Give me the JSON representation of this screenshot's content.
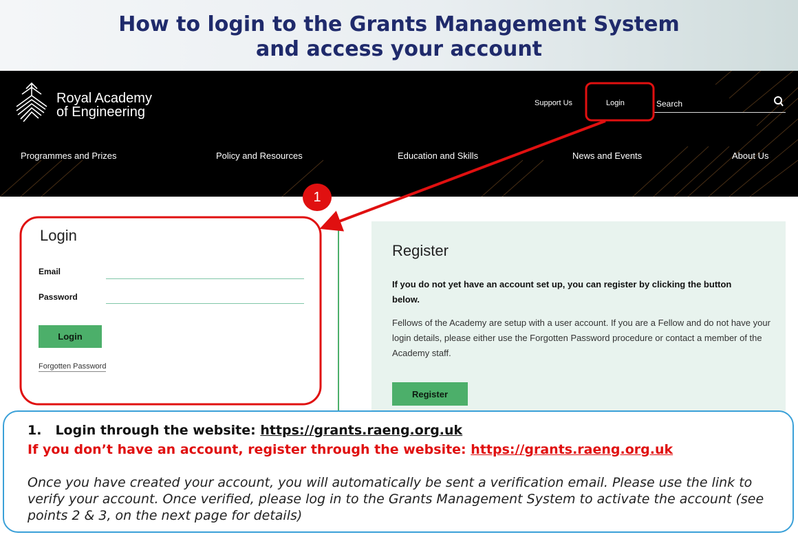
{
  "banner": {
    "line1": "How to login to the Grants Management System",
    "line2": "and access your account"
  },
  "site_header": {
    "logo_line1": "Royal Academy",
    "logo_line2": "of Engineering",
    "support_label": "Support Us",
    "login_label": "Login",
    "search_placeholder": "Search",
    "nav": [
      "Programmes and Prizes",
      "Policy and Resources",
      "Education and Skills",
      "News and Events",
      "About Us"
    ]
  },
  "login_form": {
    "title": "Login",
    "email_label": "Email",
    "password_label": "Password",
    "button_label": "Login",
    "forgot_label": "Forgotten Password"
  },
  "register_panel": {
    "title": "Register",
    "bold_text": "If you do not yet have an account set up, you can register by clicking the button below.",
    "body_text": "Fellows of the Academy are setup with a user account. If you are a Fellow and do not have your login details, please either use the Forgotten Password procedure or contact a member of the Academy staff.",
    "button_label": "Register"
  },
  "annotation": {
    "badge": "1",
    "colors": {
      "highlight": "#e01010",
      "callout_border": "#3aa0d8",
      "brand_green": "#4caf6a",
      "title_navy": "#1f2a6b"
    }
  },
  "callout": {
    "step_number": "1.",
    "step_text": "Login through the website:",
    "step_link": "https://grants.raeng.org.uk",
    "register_text": "If you don’t have an account, register through the website:",
    "register_link": "https://grants.raeng.org.uk",
    "note": "Once you have created your account, you will automatically be sent a verification email.  Please use the link to verify your account.  Once verified, please log in to the Grants Management System to activate the account (see points 2 & 3, on the next page for details)"
  }
}
